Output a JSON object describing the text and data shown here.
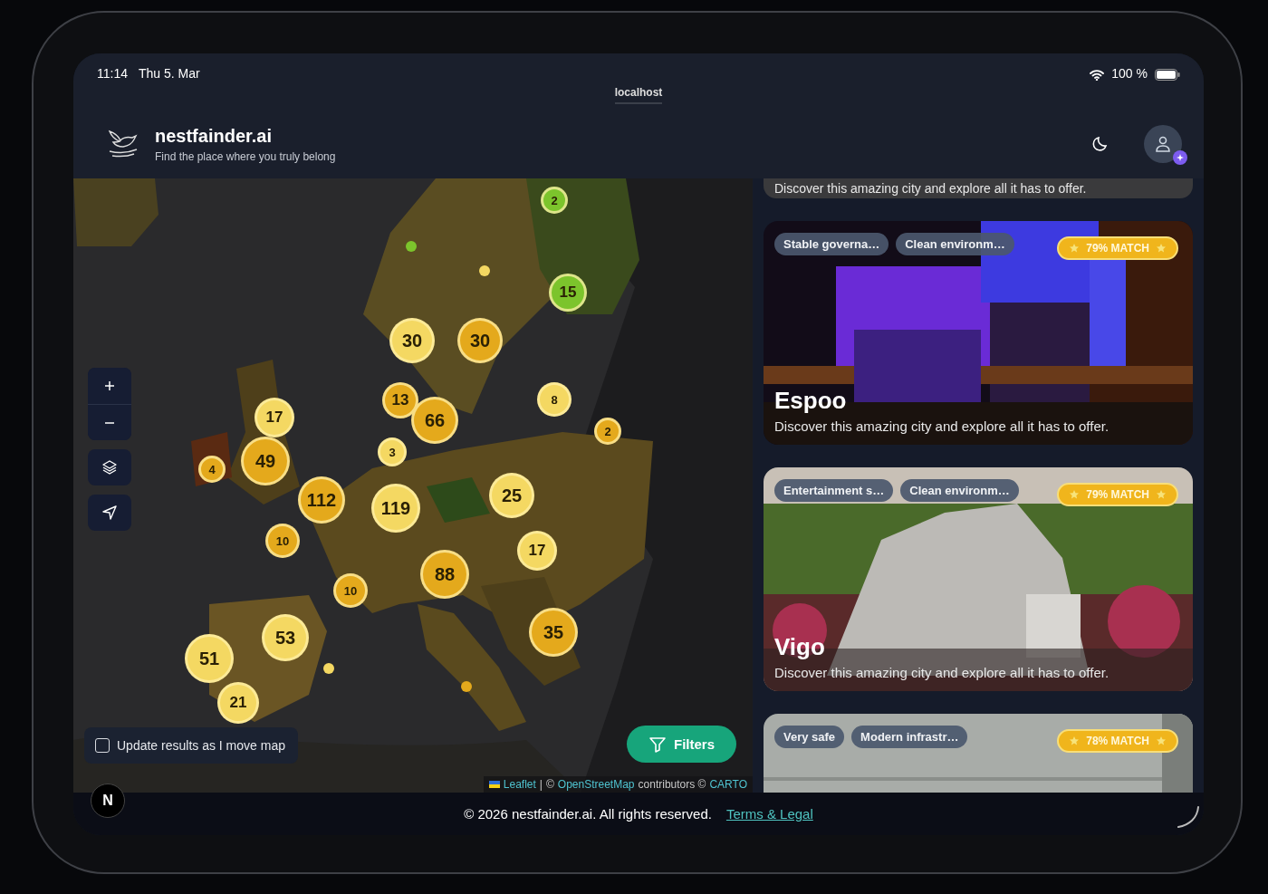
{
  "status_bar": {
    "time": "11:14",
    "date": "Thu 5. Mar",
    "battery": "100 %"
  },
  "browser": {
    "url": "localhost"
  },
  "header": {
    "brand": "nestfainder.ai",
    "tagline": "Find the place where you truly belong"
  },
  "map": {
    "clusters": [
      {
        "label": "2",
        "color": "#7cc42c"
      },
      {
        "label": "15",
        "color": "#7cc42c"
      },
      {
        "label": "30",
        "color": "#f4d862"
      },
      {
        "label": "30",
        "color": "#e4a91c"
      },
      {
        "label": "13",
        "color": "#e4a91c"
      },
      {
        "label": "66",
        "color": "#e4a91c"
      },
      {
        "label": "8",
        "color": "#f4d862"
      },
      {
        "label": "2",
        "color": "#e4a91c"
      },
      {
        "label": "17",
        "color": "#f4d862"
      },
      {
        "label": "49",
        "color": "#e4a91c"
      },
      {
        "label": "4",
        "color": "#e4a91c"
      },
      {
        "label": "3",
        "color": "#f4d862"
      },
      {
        "label": "112",
        "color": "#e4a91c"
      },
      {
        "label": "119",
        "color": "#f4d862"
      },
      {
        "label": "25",
        "color": "#f4d862"
      },
      {
        "label": "10",
        "color": "#e4a91c"
      },
      {
        "label": "17",
        "color": "#f4d862"
      },
      {
        "label": "88",
        "color": "#e4a91c"
      },
      {
        "label": "10",
        "color": "#e4a91c"
      },
      {
        "label": "35",
        "color": "#e4a91c"
      },
      {
        "label": "53",
        "color": "#f4d862"
      },
      {
        "label": "51",
        "color": "#f4d862"
      },
      {
        "label": "21",
        "color": "#f4d862"
      }
    ],
    "dots": [
      {
        "color": "#7cc42c"
      },
      {
        "color": "#f4d862"
      },
      {
        "color": "#f4d862"
      },
      {
        "color": "#e4a91c"
      }
    ],
    "update_checkbox": {
      "label": "Update results as I move map",
      "checked": false
    },
    "filters_button": "Filters",
    "attribution": [
      {
        "kind": "link",
        "text": "Leaflet"
      },
      {
        "kind": "text",
        "text": "|"
      },
      {
        "kind": "text",
        "text": "©"
      },
      {
        "kind": "link",
        "text": "OpenStreetMap"
      },
      {
        "kind": "text",
        "text": "contributors ©"
      },
      {
        "kind": "link",
        "text": "CARTO"
      }
    ]
  },
  "cards": [
    {
      "kind": "partial",
      "description": "Discover this amazing city and explore all it has to offer."
    },
    {
      "kind": "full",
      "tags": [
        "Stable governa…",
        "Clean environm…"
      ],
      "match": "79% MATCH",
      "title": "Espoo",
      "description": "Discover this amazing city and explore all it has to offer."
    },
    {
      "kind": "full",
      "tags": [
        "Entertainment s…",
        "Clean environm…"
      ],
      "match": "79% MATCH",
      "title": "Vigo",
      "description": "Discover this amazing city and explore all it has to offer."
    },
    {
      "kind": "cut",
      "tags": [
        "Very safe",
        "Modern infrastr…"
      ],
      "match": "78% MATCH"
    }
  ],
  "dev_badge": "N",
  "footer": {
    "copyright": "© 2026 nestfainder.ai. All rights reserved.",
    "link": "Terms & Legal"
  }
}
